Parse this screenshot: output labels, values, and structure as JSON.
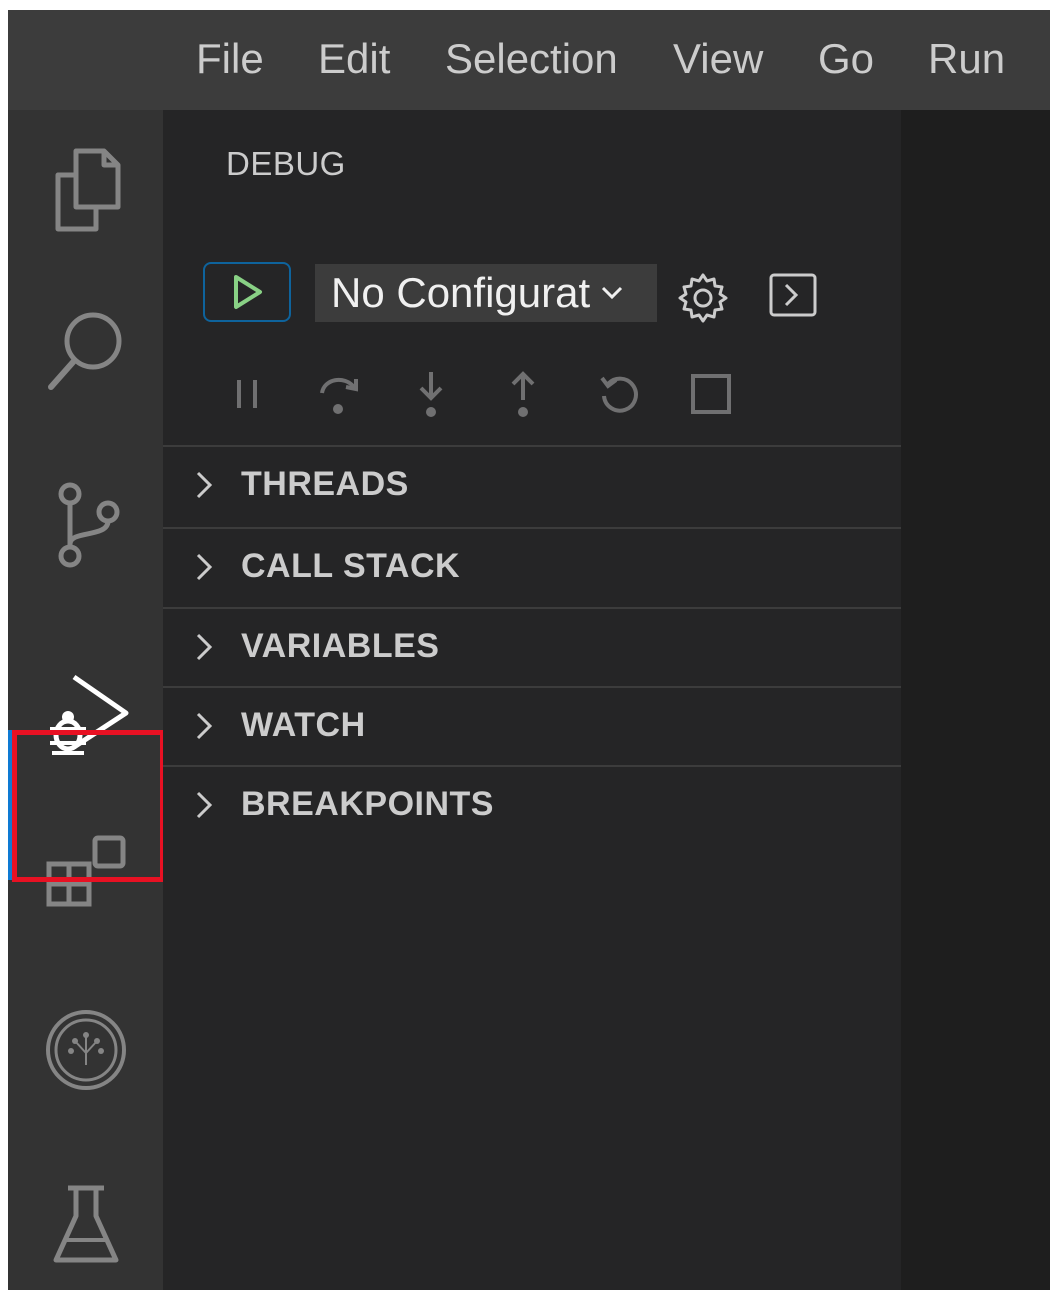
{
  "menubar": {
    "items": [
      "File",
      "Edit",
      "Selection",
      "View",
      "Go",
      "Run"
    ]
  },
  "activity_bar": {
    "items": [
      {
        "name": "explorer",
        "icon": "files-icon"
      },
      {
        "name": "search",
        "icon": "search-icon"
      },
      {
        "name": "source-control",
        "icon": "source-control-icon"
      },
      {
        "name": "run-and-debug",
        "icon": "run-debug-icon",
        "active": true
      },
      {
        "name": "extensions",
        "icon": "extensions-icon"
      },
      {
        "name": "tree-extension",
        "icon": "tree-circle-icon"
      },
      {
        "name": "testing",
        "icon": "flask-icon"
      }
    ]
  },
  "sidebar": {
    "title": "DEBUG",
    "config": {
      "selected": "No Configurat"
    },
    "debug_toolbar": [
      "pause-icon",
      "step-over-icon",
      "step-into-icon",
      "step-out-icon",
      "restart-icon",
      "stop-icon"
    ],
    "sections": [
      {
        "label": "THREADS"
      },
      {
        "label": "CALL STACK"
      },
      {
        "label": "VARIABLES"
      },
      {
        "label": "WATCH"
      },
      {
        "label": "BREAKPOINTS"
      }
    ]
  },
  "colors": {
    "menubar_bg": "#3c3c3c",
    "activity_bg": "#333333",
    "sidebar_bg": "#252526",
    "editor_bg": "#1e1e1e",
    "accent_blue": "#0e7ad3",
    "play_green": "#89d185",
    "highlight_red": "#e81123"
  }
}
